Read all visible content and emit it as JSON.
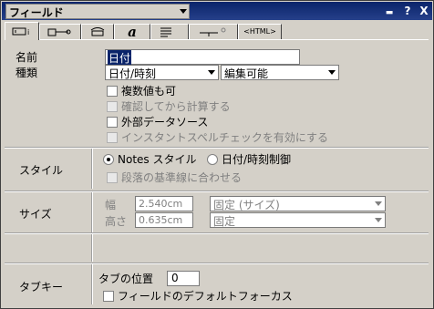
{
  "window": {
    "title": "フィールド",
    "buttons": {
      "menu": "▬",
      "help": "?",
      "close": "X"
    }
  },
  "tabs": [
    {
      "label": "",
      "icon": "field-info-icon"
    },
    {
      "label": "",
      "icon": "field-format-icon"
    },
    {
      "label": "",
      "icon": "field-control-icon"
    },
    {
      "label": "a",
      "icon": "font-icon"
    },
    {
      "label": "",
      "icon": "paragraph-icon"
    },
    {
      "label": "",
      "icon": "hide-when-icon"
    },
    {
      "label": "<HTML>",
      "icon": "html-icon"
    }
  ],
  "basics": {
    "name_label": "名前",
    "name_value": "日付",
    "type_label": "種類",
    "type_value": "日付/時刻",
    "mode_value": "編集可能",
    "checkboxes": [
      {
        "label": "複数値も可",
        "disabled": false
      },
      {
        "label": "確認してから計算する",
        "disabled": true
      },
      {
        "label": "外部データソース",
        "disabled": false
      },
      {
        "label": "インスタントスペルチェックを有効にする",
        "disabled": true
      }
    ]
  },
  "style": {
    "label": "スタイル",
    "radio1": "Notes スタイル",
    "radio2": "日付/時刻制御",
    "checkbox": "段落の基準線に合わせる"
  },
  "size": {
    "label": "サイズ",
    "width_label": "幅",
    "width_value": "2.540cm",
    "width_mode": "固定 (サイズ)",
    "height_label": "高さ",
    "height_value": "0.635cm",
    "height_mode": "固定"
  },
  "tabkey": {
    "label": "タブキー",
    "position_label": "タブの位置",
    "position_value": "0",
    "checkbox": "フィールドのデフォルトフォーカス"
  }
}
